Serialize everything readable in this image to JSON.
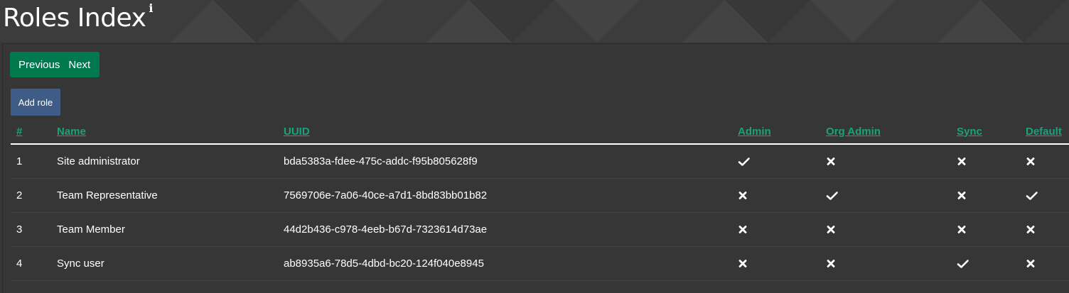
{
  "page": {
    "title": "Roles Index",
    "info_glyph": "i"
  },
  "pager": {
    "previous_label": "Previous",
    "next_label": "Next"
  },
  "actions": {
    "add_role_label": "Add role"
  },
  "colors": {
    "pager_green": "#00794f",
    "add_role_blue": "#3e5c85",
    "header_link": "#1aa37a",
    "background": "#363636"
  },
  "table": {
    "columns": [
      "#",
      "Name",
      "UUID",
      "Admin",
      "Org Admin",
      "Sync",
      "Default"
    ],
    "rows": [
      {
        "num": "1",
        "name": "Site administrator",
        "uuid": "bda5383a-fdee-475c-addc-f95b805628f9",
        "admin": true,
        "org_admin": false,
        "sync": false,
        "default": false
      },
      {
        "num": "2",
        "name": "Team Representative",
        "uuid": "7569706e-7a06-40ce-a7d1-8bd83bb01b82",
        "admin": false,
        "org_admin": true,
        "sync": false,
        "default": true
      },
      {
        "num": "3",
        "name": "Team Member",
        "uuid": "44d2b436-c978-4eeb-b67d-7323614d73ae",
        "admin": false,
        "org_admin": false,
        "sync": false,
        "default": false
      },
      {
        "num": "4",
        "name": "Sync user",
        "uuid": "ab8935a6-78d5-4dbd-bc20-124f040e8945",
        "admin": false,
        "org_admin": false,
        "sync": true,
        "default": false
      }
    ]
  },
  "icons": {
    "true": "check-icon",
    "false": "cross-icon"
  }
}
